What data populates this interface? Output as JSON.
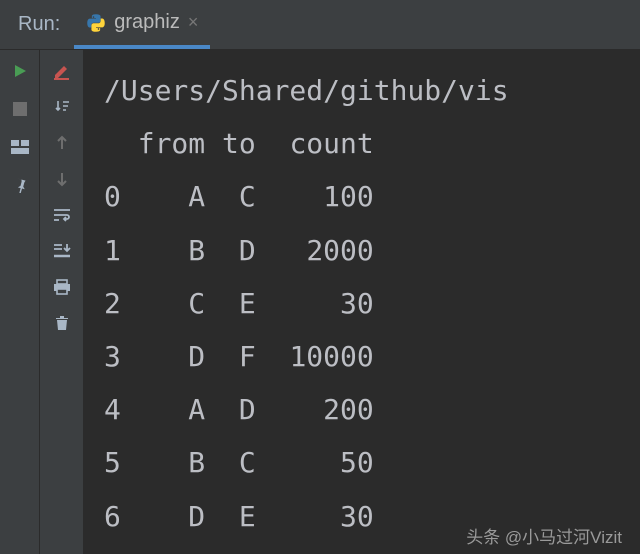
{
  "header": {
    "run_label": "Run:",
    "tab_label": "graphiz",
    "tab_close": "×"
  },
  "console": {
    "path": "/Users/Shared/github/vis",
    "headers": {
      "idx": "",
      "from": "from",
      "to": "to",
      "count": "count"
    },
    "rows": [
      {
        "idx": "0",
        "from": "A",
        "to": "C",
        "count": "100"
      },
      {
        "idx": "1",
        "from": "B",
        "to": "D",
        "count": "2000"
      },
      {
        "idx": "2",
        "from": "C",
        "to": "E",
        "count": "30"
      },
      {
        "idx": "3",
        "from": "D",
        "to": "F",
        "count": "10000"
      },
      {
        "idx": "4",
        "from": "A",
        "to": "D",
        "count": "200"
      },
      {
        "idx": "5",
        "from": "B",
        "to": "C",
        "count": "50"
      },
      {
        "idx": "6",
        "from": "D",
        "to": "E",
        "count": "30"
      }
    ]
  },
  "watermark": "头条 @小马过河Vizit"
}
